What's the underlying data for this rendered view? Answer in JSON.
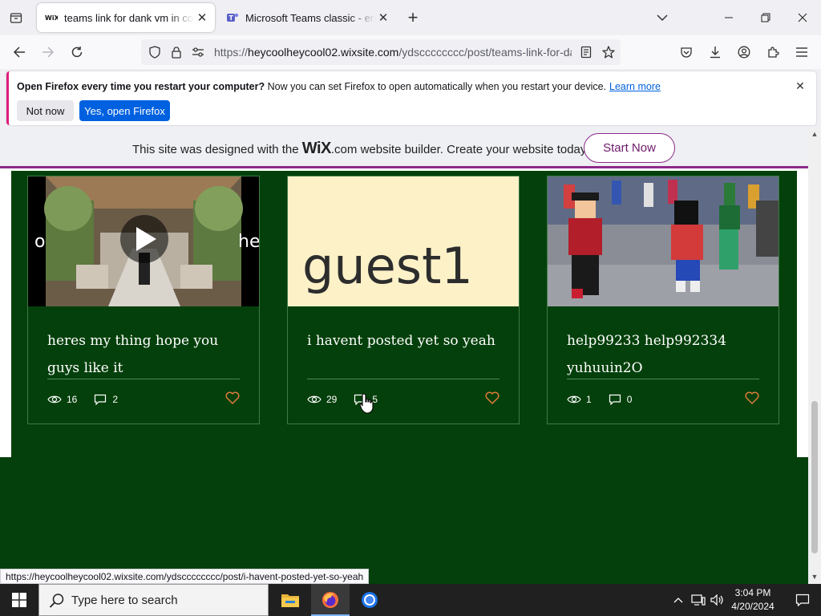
{
  "browser": {
    "tabs": [
      {
        "title": "teams link for dank vm in comments",
        "active": true,
        "favicon": "wix-favicon"
      },
      {
        "title": "Microsoft Teams classic - error",
        "active": false,
        "favicon": "teams-favicon"
      }
    ],
    "url_host": "heycoolheycool02.wixsite.com",
    "url_path": "/ydscccccccc/post/teams-link-for-dank",
    "url_prefix": "https://"
  },
  "notification": {
    "bold_text": "Open Firefox every time you restart your computer?",
    "text": " Now you can set Firefox to open automatically when you restart your device.",
    "learn_more": "Learn more",
    "not_now": "Not now",
    "yes_open": "Yes, open Firefox"
  },
  "wix_banner": {
    "text_before": "This site was designed with the ",
    "wix_logo": "WiX",
    "text_after": ".com website builder. Create your website today.",
    "cta": "Start Now"
  },
  "posts": [
    {
      "title": "heres my thing hope you guys like it",
      "views": "16",
      "comments": "2",
      "thumb": "video-wedding"
    },
    {
      "title": "i havent posted yet so yeah",
      "views": "29",
      "comments": "5",
      "thumb_text": "guest1"
    },
    {
      "title": "help99233 help992334 yuhuuin2O",
      "views": "1",
      "comments": "0",
      "thumb": "roblox-scene"
    }
  ],
  "status_bar_url": "https://heycoolheycool02.wixsite.com/ydscccccccc/post/i-havent-posted-yet-so-yeah",
  "taskbar": {
    "search_placeholder": "Type here to search",
    "time": "3:04 PM",
    "date": "4/20/2024"
  },
  "colors": {
    "site_bg": "#04400b",
    "wix_accent": "#8d2a8a",
    "firefox_blue": "#0061e0",
    "heart": "#e07b39"
  }
}
